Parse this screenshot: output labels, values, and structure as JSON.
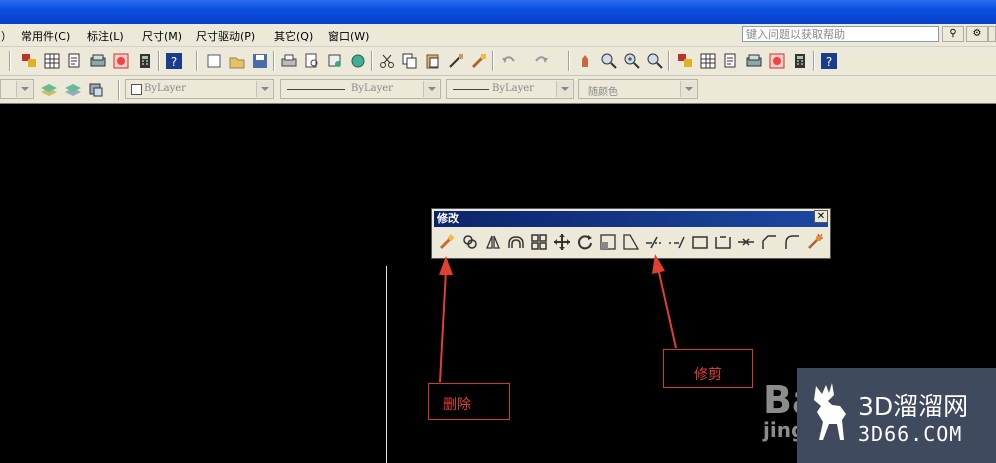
{
  "menubar": {
    "items": [
      "）",
      "常用件(C)",
      "标注(L)",
      "尺寸(M)",
      "尺寸驱动(P)",
      "其它(Q)",
      "窗口(W)"
    ],
    "help_placeholder": "键入问题以获取帮助"
  },
  "toolbar2": {
    "layer_color": "ByLayer",
    "linetype": "ByLayer",
    "lineweight": "ByLayer",
    "plotstyle": "随颜色"
  },
  "modify_toolbar": {
    "title": "修改",
    "close": "✕",
    "tools": [
      "erase",
      "copy",
      "mirror",
      "offset",
      "array",
      "move",
      "rotate",
      "scale",
      "stretch",
      "trim",
      "extend",
      "break-at-point",
      "break",
      "join",
      "chamfer",
      "fillet",
      "explode"
    ]
  },
  "annotations": {
    "erase_label": "删除",
    "trim_label": "修剪"
  },
  "watermark": {
    "site_name": "3D溜溜网",
    "site_url": "3D66.COM",
    "baidu_text": "Ba",
    "baidu_sub": "jing"
  },
  "colors": {
    "accent_red": "#e04030",
    "title_blue": "#0a4fe0",
    "canvas": "#000000"
  }
}
